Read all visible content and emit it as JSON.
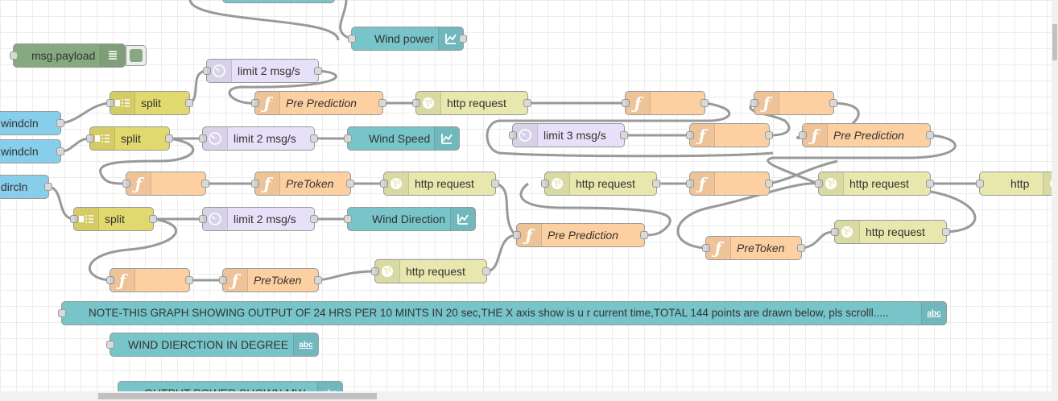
{
  "colors": {
    "function": "#fdd0a2",
    "http": "#e7e7ae",
    "delay": "#e6e0f8",
    "chart": "#77c4c9",
    "debug": "#87a980",
    "split": "#e2d96e",
    "inject": "#87ceeb",
    "wire": "#999999"
  },
  "nodes": [
    {
      "type": "chart",
      "label": "Wind power",
      "icon": "chart-icon"
    },
    {
      "type": "debug",
      "label": "msg.payload",
      "icon": "list-icon"
    },
    {
      "type": "delay",
      "label": "limit 2 msg/s",
      "icon": "timer-icon"
    },
    {
      "type": "split",
      "label": "split",
      "icon": "split-icon"
    },
    {
      "type": "function",
      "label": "Pre Prediction",
      "icon": "function-icon"
    },
    {
      "type": "http",
      "label": "http request",
      "icon": "globe-icon"
    },
    {
      "type": "function",
      "label": "",
      "icon": "function-icon"
    },
    {
      "type": "function",
      "label": "",
      "icon": "function-icon"
    },
    {
      "type": "inject",
      "label": "windcln",
      "icon": ""
    },
    {
      "type": "split",
      "label": "split",
      "icon": "split-icon"
    },
    {
      "type": "delay",
      "label": "limit 2 msg/s",
      "icon": "timer-icon"
    },
    {
      "type": "chart",
      "label": "Wind Speed",
      "icon": "chart-icon"
    },
    {
      "type": "delay",
      "label": "limit 3 msg/s",
      "icon": "timer-icon"
    },
    {
      "type": "function",
      "label": "",
      "icon": "function-icon"
    },
    {
      "type": "function",
      "label": "Pre Prediction",
      "icon": "function-icon"
    },
    {
      "type": "inject",
      "label": "windcln",
      "icon": ""
    },
    {
      "type": "function",
      "label": "",
      "icon": "function-icon"
    },
    {
      "type": "function",
      "label": "PreToken",
      "icon": "function-icon"
    },
    {
      "type": "http",
      "label": "http request",
      "icon": "globe-icon"
    },
    {
      "type": "http",
      "label": "http request",
      "icon": "globe-icon"
    },
    {
      "type": "function",
      "label": "",
      "icon": "function-icon"
    },
    {
      "type": "http",
      "label": "http request",
      "icon": "globe-icon"
    },
    {
      "type": "http",
      "label": "http",
      "icon": "globe-icon"
    },
    {
      "type": "inject",
      "label": "dircln",
      "icon": ""
    },
    {
      "type": "split",
      "label": "split",
      "icon": "split-icon"
    },
    {
      "type": "delay",
      "label": "limit 2 msg/s",
      "icon": "timer-icon"
    },
    {
      "type": "chart",
      "label": "Wind Direction",
      "icon": "chart-icon"
    },
    {
      "type": "function",
      "label": "Pre Prediction",
      "icon": "function-icon"
    },
    {
      "type": "http",
      "label": "http request",
      "icon": "globe-icon"
    },
    {
      "type": "function",
      "label": "PreToken",
      "icon": "function-icon"
    },
    {
      "type": "function",
      "label": "",
      "icon": "function-icon"
    },
    {
      "type": "function",
      "label": "PreToken",
      "icon": "function-icon"
    },
    {
      "type": "http",
      "label": "http request",
      "icon": "globe-icon"
    },
    {
      "type": "chart",
      "label": "NOTE-THIS GRAPH SHOWING OUTPUT OF 24 HRS PER 10 MINTS IN 20 sec,THE X axis show is u r current time,TOTAL 144 points are drawn below, pls scrolll.....",
      "icon": "text-icon"
    },
    {
      "type": "chart",
      "label": "WIND DIERCTION IN DEGREE",
      "icon": "text-icon"
    },
    {
      "type": "chart",
      "label": "OUTPUT POWER SHOWN MW",
      "icon": "text-icon"
    }
  ],
  "icon_glyphs": {
    "function-icon": "ƒ",
    "text-icon": "abc"
  }
}
